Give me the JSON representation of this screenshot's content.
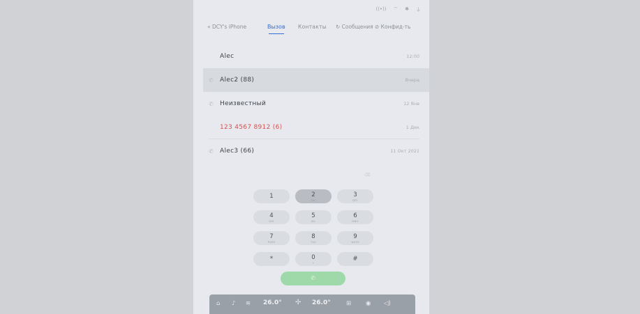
{
  "status_icons": [
    "signal-icon",
    "wifi-icon",
    "bluetooth-icon",
    "usb-icon"
  ],
  "header": {
    "back_label": "« DCY's iPhone",
    "tabs": [
      {
        "label": "Вызов",
        "active": true
      },
      {
        "label": "Контакты",
        "active": false
      },
      {
        "label": "↻ Сообщения",
        "active": false
      },
      {
        "label": "⊘ Конфид-ть",
        "active": false
      }
    ]
  },
  "calls": [
    {
      "name": "Alec",
      "time": "12:00",
      "icon": "none",
      "missed": false,
      "selected": false
    },
    {
      "name": "Alec2 (88)",
      "time": "Вчера",
      "icon": "phone-incoming-icon",
      "missed": false,
      "selected": true
    },
    {
      "name": "Неизвестный",
      "time": "12 Янв",
      "icon": "phone-incoming-icon",
      "missed": false,
      "selected": false
    },
    {
      "name": "123 4567 8912 (6)",
      "time": "1 Дек",
      "icon": "none",
      "missed": true,
      "selected": false
    },
    {
      "name": "Alec3 (66)",
      "time": "11 Окт 2021",
      "icon": "phone-incoming-icon",
      "missed": false,
      "selected": false
    }
  ],
  "dialer": {
    "display_hint": "⌫",
    "keys": [
      {
        "digit": "1",
        "letters": ""
      },
      {
        "digit": "2",
        "letters": "ABC"
      },
      {
        "digit": "3",
        "letters": "DEF"
      },
      {
        "digit": "4",
        "letters": "GHI"
      },
      {
        "digit": "5",
        "letters": "JKL"
      },
      {
        "digit": "6",
        "letters": "MNO"
      },
      {
        "digit": "7",
        "letters": "PQRS"
      },
      {
        "digit": "8",
        "letters": "TUV"
      },
      {
        "digit": "9",
        "letters": "WXYZ"
      },
      {
        "digit": "*",
        "letters": ""
      },
      {
        "digit": "0",
        "letters": "+"
      },
      {
        "digit": "#",
        "letters": ""
      }
    ],
    "call_label": "✆"
  },
  "bottom_bar": {
    "home_icon": "⌂",
    "music_icon": "♪",
    "seat_icon": "≋",
    "temp_left": "26.0°",
    "fan_icon": "✢",
    "temp_right": "26.0°",
    "apps_icon": "⊞",
    "media_icon": "◉",
    "volume_icon": "◁)"
  },
  "colors": {
    "accent": "#2f6fd6",
    "missed": "#d6504f",
    "call_button": "#9fd8a9",
    "bottom_bar": "#9aa0a8"
  }
}
